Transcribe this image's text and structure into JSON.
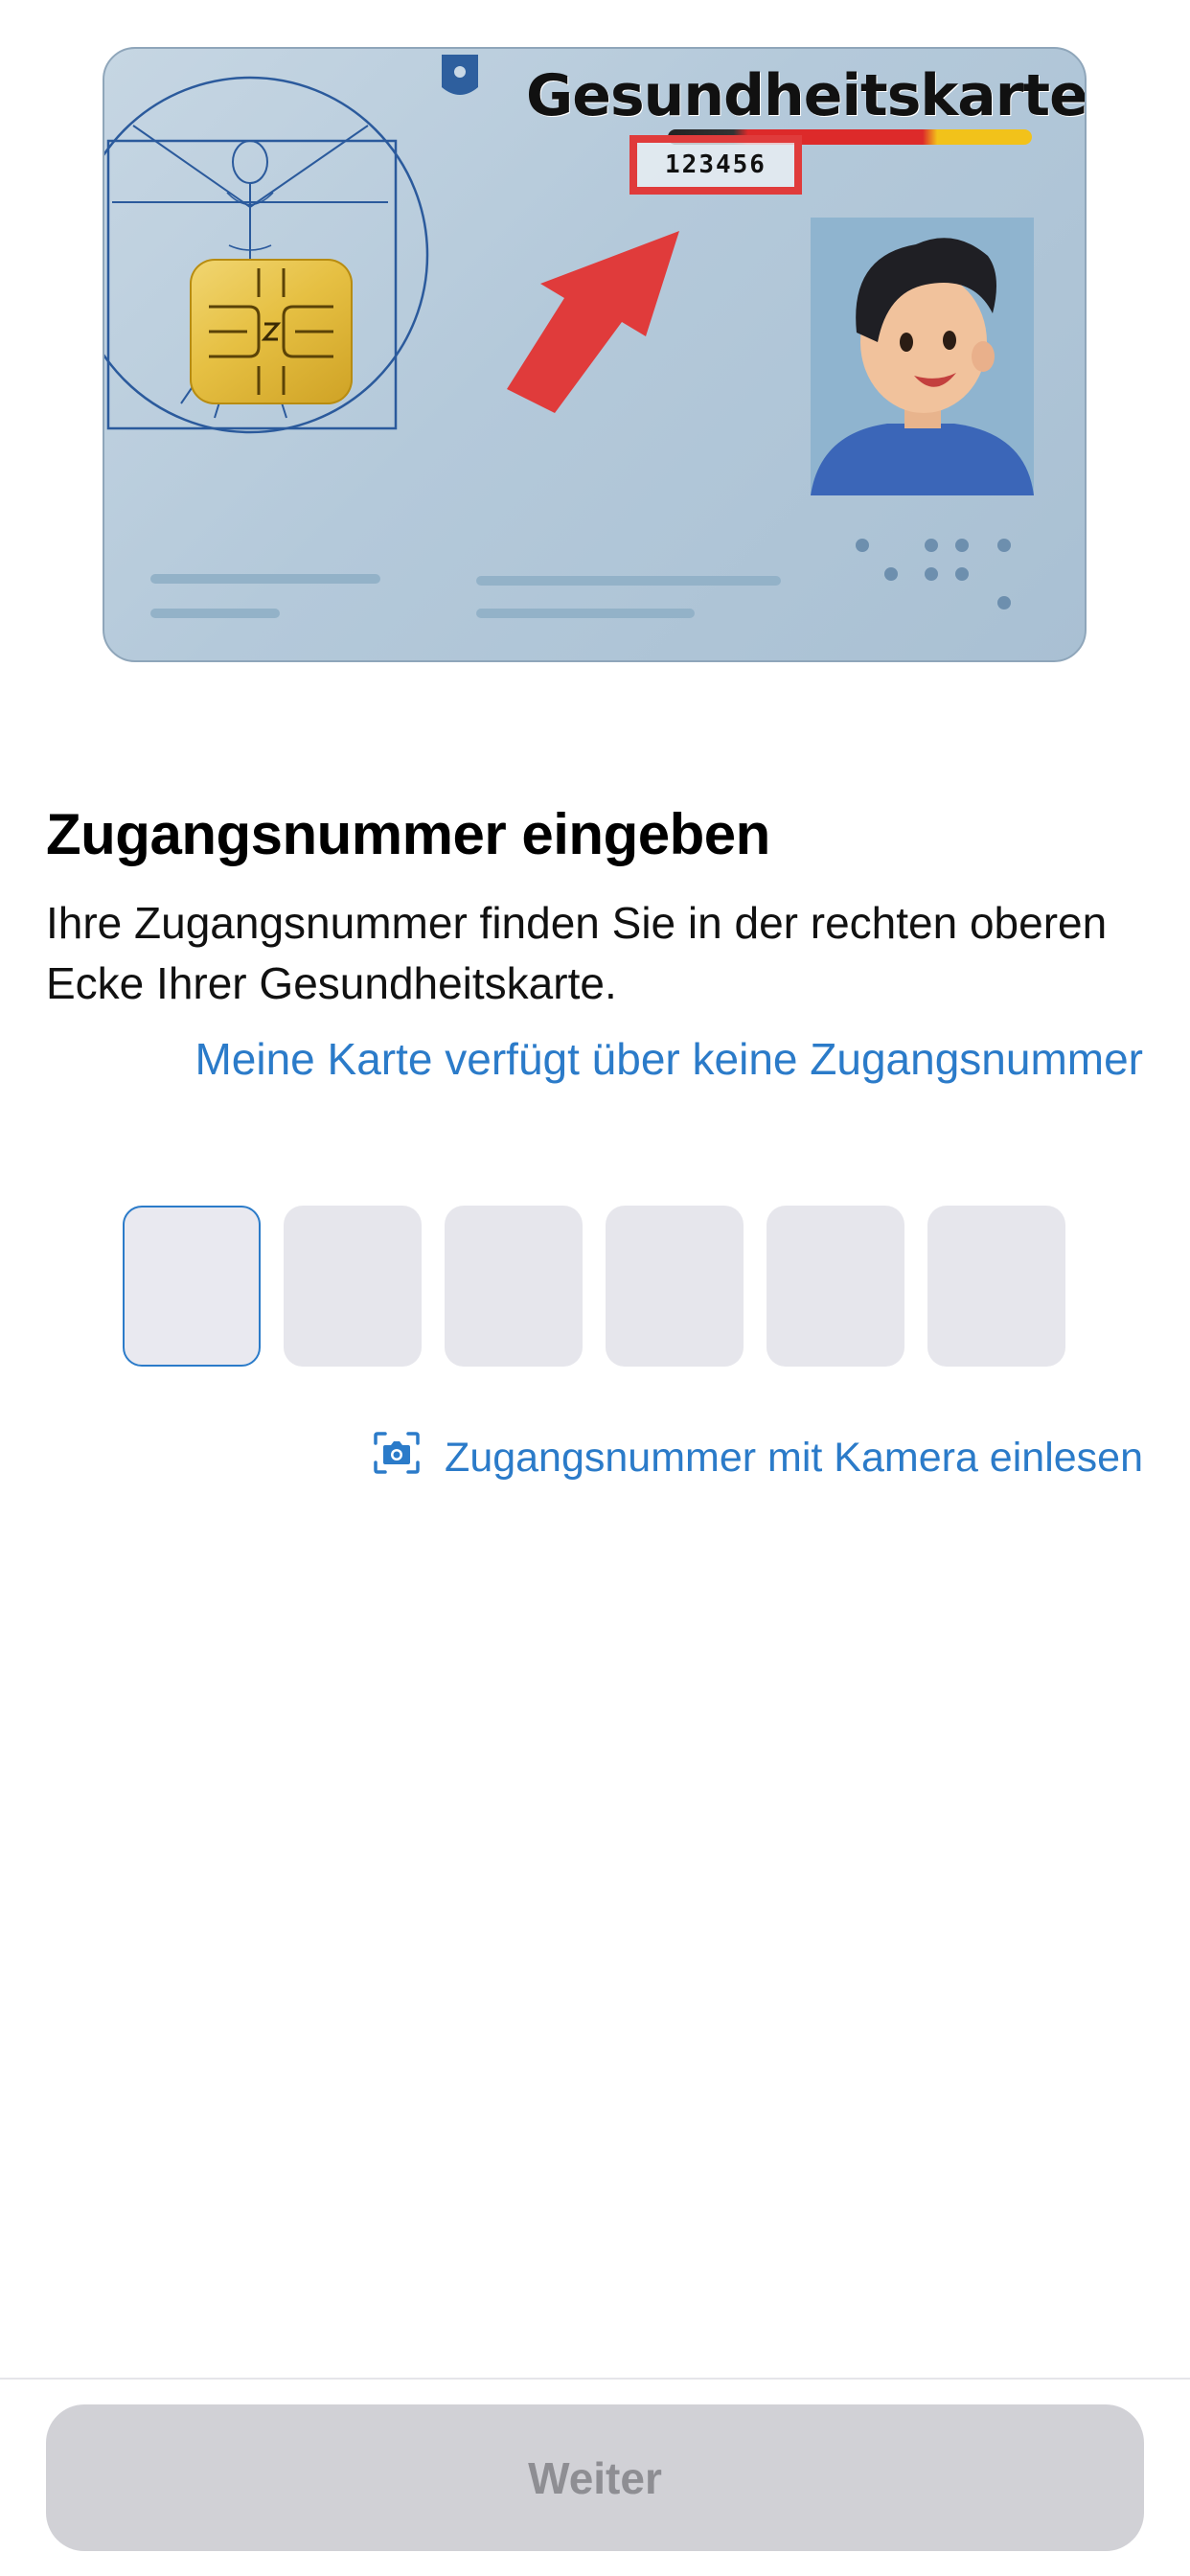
{
  "card_illustration": {
    "title": "Gesundheitskarte",
    "access_number": "123456"
  },
  "content": {
    "heading": "Zugangsnummer eingeben",
    "description": "Ihre Zugangsnummer finden Sie in der rechten oberen Ecke Ihrer Gesundheitskarte.",
    "no_number_link": "Meine Karte verfügt über keine Zugangsnummer",
    "camera_link": "Zugangsnummer mit Kamera einlesen",
    "camera_icon": "camera-scan-icon"
  },
  "code_input": {
    "digits": [
      "",
      "",
      "",
      "",
      "",
      ""
    ],
    "active_index": 0
  },
  "footer": {
    "continue_label": "Weiter",
    "continue_enabled": false
  },
  "colors": {
    "accent": "#2b7bc9",
    "highlight_red": "#e03b3b",
    "button_disabled_bg": "#d1d1d6",
    "button_disabled_text": "#8e8e93"
  }
}
